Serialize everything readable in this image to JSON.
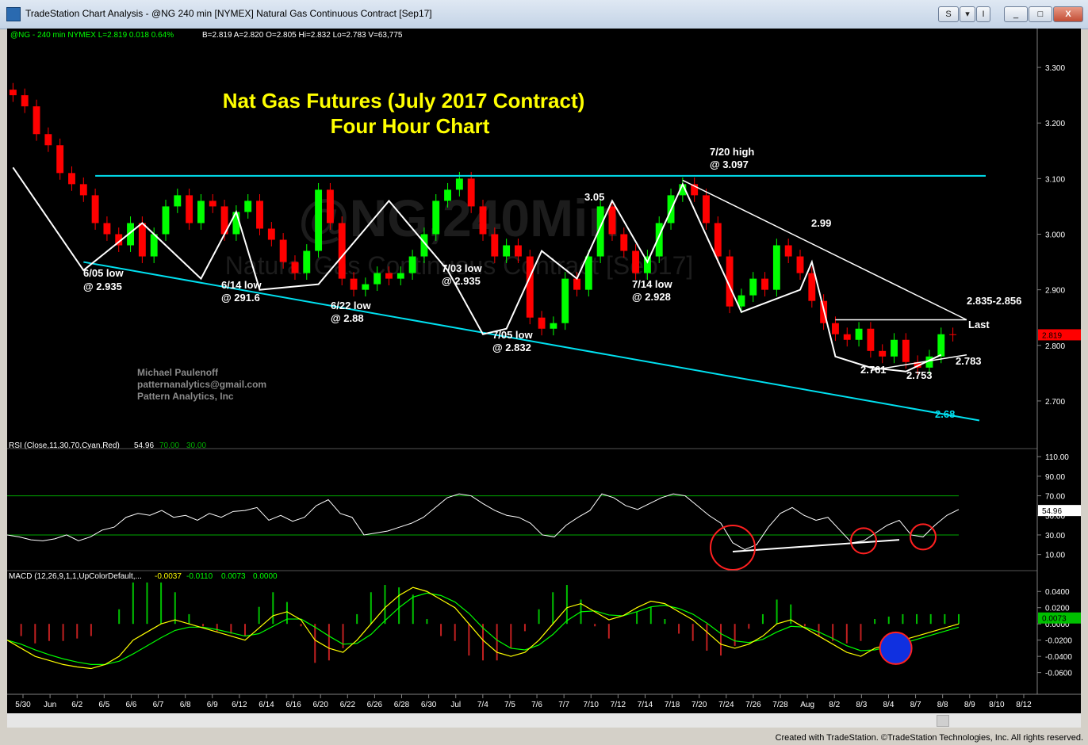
{
  "window": {
    "title": "TradeStation Chart Analysis - @NG 240 min [NYMEX] Natural Gas Continuous Contract [Sep17]",
    "buttons": [
      "S",
      "I",
      "_",
      "□",
      "X"
    ]
  },
  "header": {
    "symbol_line": "@NG - 240 min  NYMEX  L=2.819  0.018  0.64%",
    "quote_line": "B=2.819  A=2.820  O=2.805  Hi=2.832  Lo=2.783  V=63,775"
  },
  "watermark": {
    "line1": "@NG,240Min",
    "line2": "Natural Gas Continuous Contract [Sep17]"
  },
  "author": {
    "name": "Michael Paulenoff",
    "email": "patternanalytics@gmail.com",
    "company": "Pattern Analytics, Inc"
  },
  "indicators": {
    "rsi_label": "RSI (Close,11,30,70,Cyan,Red)",
    "rsi_values": [
      "54.96",
      "70.00",
      "30.00"
    ],
    "macd_label": "MACD (12,26,9,1,1,UpColorDefault,...",
    "macd_values": [
      "-0.0037",
      "-0.0110",
      "0.0073",
      "0.0000"
    ]
  },
  "status": {
    "text": "Created with TradeStation. ©TradeStation Technologies, Inc. All rights reserved."
  },
  "colors": {
    "background": "#000000",
    "price_axis_last": "#ff0000",
    "channel": "#00e0f0",
    "annotation_title": "#ffff00",
    "rsi_line": "#ffffff",
    "macd": "#ffff00",
    "signal": "#00ff00"
  },
  "chart_data": [
    {
      "type": "candlestick",
      "title": "Nat Gas Futures (July 2017 Contract)",
      "subtitle": "Four Hour Chart",
      "ylim": [
        2.64,
        3.35
      ],
      "yticks": [
        2.7,
        2.8,
        2.9,
        3.0,
        3.1,
        3.2,
        3.3
      ],
      "ytick_labels": [
        "2.700",
        "2.800",
        "2.900",
        "3.000",
        "3.100",
        "3.200",
        "3.300"
      ],
      "last_price": "2.819",
      "xtick_labels": [
        "5/30",
        "Jun",
        "6/2",
        "6/5",
        "6/6",
        "6/7",
        "6/8",
        "6/9",
        "6/12",
        "6/14",
        "6/16",
        "6/20",
        "6/22",
        "6/26",
        "6/28",
        "6/30",
        "Jul",
        "7/4",
        "7/5",
        "7/6",
        "7/7",
        "7/10",
        "7/12",
        "7/14",
        "7/18",
        "7/20",
        "7/24",
        "7/26",
        "7/28",
        "Aug",
        "8/2",
        "8/3",
        "8/4",
        "8/7",
        "8/8",
        "8/9",
        "8/10",
        "8/12"
      ],
      "close_path": [
        3.25,
        3.23,
        3.18,
        3.16,
        3.11,
        3.09,
        3.07,
        3.02,
        3.0,
        2.98,
        3.02,
        2.96,
        3.0,
        3.05,
        3.07,
        3.02,
        3.06,
        3.05,
        3.0,
        3.04,
        3.06,
        3.01,
        2.99,
        2.95,
        2.93,
        2.97,
        3.08,
        3.02,
        2.92,
        2.9,
        2.91,
        2.93,
        2.92,
        2.93,
        2.96,
        3.0,
        3.06,
        3.08,
        3.1,
        3.05,
        3.0,
        2.96,
        2.98,
        2.96,
        2.85,
        2.83,
        2.84,
        2.92,
        2.9,
        2.96,
        3.05,
        3.0,
        2.97,
        2.93,
        2.96,
        3.02,
        3.07,
        3.09,
        3.07,
        3.02,
        2.96,
        2.87,
        2.89,
        2.92,
        2.9,
        2.98,
        2.96,
        2.93,
        2.88,
        2.84,
        2.82,
        2.81,
        2.83,
        2.79,
        2.78,
        2.81,
        2.77,
        2.76,
        2.78,
        2.82,
        2.819
      ],
      "annotations": [
        {
          "label": "6/05 low",
          "value": "@ 2.935"
        },
        {
          "label": "6/14 low",
          "value": "@ 291.6"
        },
        {
          "label": "6/22 low",
          "value": "@ 2.88"
        },
        {
          "label": "7/03 low",
          "value": "@ 2.935"
        },
        {
          "label": "7/05 low",
          "value": "@ 2.832"
        },
        {
          "label": "3.05",
          "value": ""
        },
        {
          "label": "7/14 low",
          "value": "@ 2.928"
        },
        {
          "label": "7/20 high",
          "value": "@ 3.097"
        },
        {
          "label": "2.99",
          "value": ""
        },
        {
          "label": "2.835-2.856",
          "value": ""
        },
        {
          "label": "Last",
          "value": ""
        },
        {
          "label": "2.761",
          "value": ""
        },
        {
          "label": "2.753",
          "value": ""
        },
        {
          "label": "2.783",
          "value": ""
        },
        {
          "label": "2.68",
          "value": ""
        }
      ],
      "resistance_level": 3.105,
      "zigzag": [
        [
          0,
          3.12
        ],
        [
          6,
          2.935
        ],
        [
          11,
          3.02
        ],
        [
          16,
          2.92
        ],
        [
          19,
          3.04
        ],
        [
          21,
          2.9
        ],
        [
          26,
          2.91
        ],
        [
          32,
          3.06
        ],
        [
          37,
          2.935
        ],
        [
          40,
          2.82
        ],
        [
          42,
          2.83
        ],
        [
          45,
          2.97
        ],
        [
          48,
          2.92
        ],
        [
          51,
          3.06
        ],
        [
          54,
          2.95
        ],
        [
          57,
          3.09
        ],
        [
          62,
          2.86
        ],
        [
          67,
          2.9
        ],
        [
          68,
          2.95
        ],
        [
          70,
          2.78
        ],
        [
          73,
          2.76
        ],
        [
          76,
          2.753
        ],
        [
          79,
          2.783
        ]
      ]
    },
    {
      "type": "line",
      "name_label": "RSI (Close,11,30,70,Cyan,Red)",
      "ylim": [
        0,
        115
      ],
      "yticks": [
        10,
        30,
        50,
        70,
        90,
        110
      ],
      "ytick_labels": [
        "10.00",
        "30.00",
        "50.00",
        "70.00",
        "90.00",
        "110.00"
      ],
      "levels": [
        30,
        70
      ],
      "last_value": "54.96",
      "values": [
        30,
        28,
        25,
        24,
        26,
        30,
        24,
        28,
        35,
        38,
        48,
        52,
        50,
        55,
        48,
        50,
        45,
        52,
        48,
        54,
        55,
        58,
        45,
        50,
        44,
        48,
        60,
        66,
        52,
        48,
        30,
        32,
        34,
        38,
        42,
        48,
        58,
        68,
        72,
        70,
        62,
        55,
        50,
        48,
        42,
        30,
        28,
        40,
        48,
        55,
        72,
        68,
        60,
        56,
        62,
        68,
        72,
        70,
        60,
        50,
        42,
        22,
        15,
        20,
        38,
        52,
        58,
        50,
        45,
        48,
        35,
        22,
        24,
        32,
        40,
        45,
        30,
        28,
        40,
        50,
        56
      ]
    },
    {
      "type": "line",
      "name_label": "MACD (12,26,9,1,1,UpColorDefault,...",
      "ylim": [
        -0.075,
        0.05
      ],
      "yticks": [
        -0.06,
        -0.04,
        -0.02,
        0.0,
        0.02,
        0.04
      ],
      "ytick_labels": [
        "-0.0600",
        "-0.0400",
        "-0.0200",
        "0.0000",
        "0.0200",
        "0.0400"
      ],
      "last_value": "0.0073",
      "macd": [
        -0.02,
        -0.03,
        -0.04,
        -0.045,
        -0.05,
        -0.053,
        -0.055,
        -0.05,
        -0.04,
        -0.02,
        -0.01,
        0.0,
        0.005,
        0.0,
        -0.005,
        -0.01,
        -0.015,
        -0.02,
        -0.005,
        0.01,
        0.015,
        0.005,
        -0.02,
        -0.03,
        -0.035,
        -0.02,
        0.0,
        0.02,
        0.035,
        0.045,
        0.04,
        0.03,
        0.02,
        0.0,
        -0.02,
        -0.035,
        -0.04,
        -0.035,
        -0.02,
        0.0,
        0.02,
        0.025,
        0.015,
        0.005,
        0.01,
        0.02,
        0.028,
        0.025,
        0.015,
        0.005,
        -0.01,
        -0.025,
        -0.03,
        -0.025,
        -0.015,
        0.0,
        0.005,
        -0.005,
        -0.015,
        -0.025,
        -0.035,
        -0.04,
        -0.03,
        -0.025,
        -0.02,
        -0.015,
        -0.01,
        -0.005,
        0.0
      ],
      "signal": [
        -0.02,
        -0.025,
        -0.032,
        -0.038,
        -0.043,
        -0.047,
        -0.05,
        -0.05,
        -0.046,
        -0.037,
        -0.027,
        -0.017,
        -0.008,
        -0.004,
        -0.004,
        -0.007,
        -0.011,
        -0.015,
        -0.012,
        -0.003,
        0.006,
        0.006,
        -0.004,
        -0.015,
        -0.025,
        -0.024,
        -0.013,
        0.004,
        0.02,
        0.033,
        0.038,
        0.035,
        0.027,
        0.013,
        -0.005,
        -0.02,
        -0.03,
        -0.032,
        -0.026,
        -0.013,
        0.004,
        0.015,
        0.016,
        0.011,
        0.01,
        0.015,
        0.021,
        0.023,
        0.019,
        0.012,
        0.001,
        -0.012,
        -0.021,
        -0.023,
        -0.019,
        -0.01,
        -0.003,
        -0.004,
        -0.01,
        -0.018,
        -0.027,
        -0.033,
        -0.032,
        -0.028,
        -0.024,
        -0.019,
        -0.014,
        -0.009,
        -0.004
      ]
    }
  ]
}
